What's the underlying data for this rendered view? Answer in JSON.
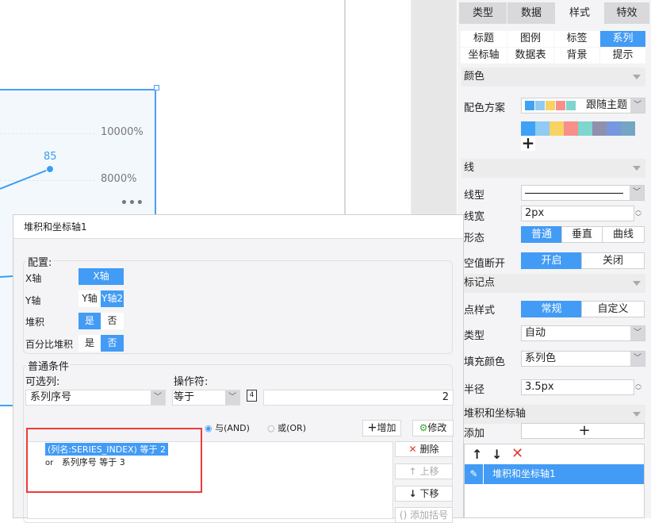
{
  "chart": {
    "y_ticks": [
      "10000%",
      "8000%"
    ],
    "point_label": "85",
    "more_icon": "more-dots-icon",
    "series_color": "#3a9df3"
  },
  "panel": {
    "tabs": [
      {
        "label": "类型"
      },
      {
        "label": "数据"
      },
      {
        "label": "样式"
      },
      {
        "label": "特效"
      }
    ],
    "subtabs": [
      {
        "label": "标题"
      },
      {
        "label": "图例"
      },
      {
        "label": "标签"
      },
      {
        "label": "系列"
      },
      {
        "label": "坐标轴"
      },
      {
        "label": "数据表"
      },
      {
        "label": "背景"
      },
      {
        "label": "提示"
      }
    ],
    "color_section": {
      "title": "颜色",
      "scheme_label": "配色方案",
      "scheme_value": "跟随主题",
      "swatches": [
        "#3fa2f5",
        "#8fcbf2",
        "#f6d362",
        "#f78f8b",
        "#7ed6cf",
        "#8f90ad",
        "#7798e0",
        "#74a5c4"
      ]
    },
    "line_section": {
      "title": "线",
      "type_label": "线型",
      "width_label": "线宽",
      "width_value": "2px",
      "shape_label": "形态",
      "shape_options": [
        "普通",
        "垂直",
        "曲线"
      ],
      "null_label": "空值断开",
      "null_options": [
        "开启",
        "关闭"
      ]
    },
    "marker_section": {
      "title": "标记点",
      "style_label": "点样式",
      "style_options": [
        "常规",
        "自定义"
      ],
      "type_label": "类型",
      "type_value": "自动",
      "fill_label": "填充颜色",
      "fill_value": "系列色",
      "radius_label": "半径",
      "radius_value": "3.5px"
    },
    "stack_section": {
      "title": "堆积和坐标轴",
      "add_label": "添加",
      "items": [
        "堆积和坐标轴1"
      ]
    }
  },
  "dialog": {
    "title": "堆积和坐标轴1",
    "config": {
      "legend": "配置:",
      "x_label": "X轴",
      "x_options": [
        "X轴"
      ],
      "y_label": "Y轴",
      "y_options": [
        "Y轴",
        "Y轴2"
      ],
      "stack_label": "堆积",
      "stack_options": [
        "是",
        "否"
      ],
      "percent_label": "百分比堆积",
      "percent_options": [
        "是",
        "否"
      ]
    },
    "condition": {
      "legend": "普通条件",
      "column_label": "可选列:",
      "column_value": "系列序号",
      "operator_label": "操作符:",
      "operator_value": "等于",
      "type_badge": "4",
      "value": "2",
      "and_label": "与(AND)",
      "or_label": "或(OR)",
      "add_label": "增加",
      "modify_label": "修改",
      "delete_label": "删除",
      "up_label": "上移",
      "down_label": "下移",
      "bracket_label": "添加括号",
      "rows": [
        {
          "text": "(列名:SERIES_INDEX) 等于 2"
        },
        {
          "prefix": "or",
          "text": "系列序号 等于 3"
        }
      ]
    }
  }
}
